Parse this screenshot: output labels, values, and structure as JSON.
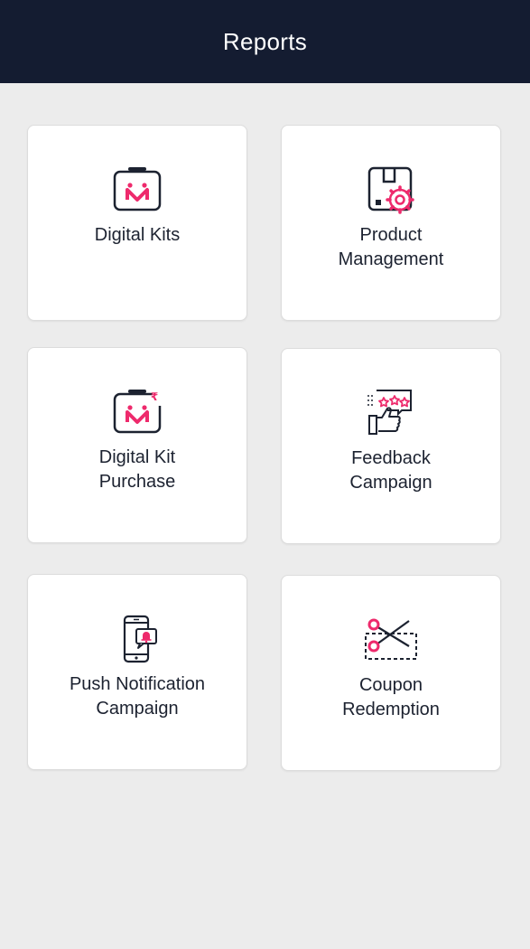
{
  "header": {
    "title": "Reports"
  },
  "colors": {
    "header_bg": "#141c31",
    "page_bg": "#ececec",
    "card_bg": "#ffffff",
    "icon_dark": "#1c2230",
    "icon_accent": "#ee2a6c"
  },
  "cards": [
    {
      "label": "Digital Kits",
      "icon": "digital-kit-icon"
    },
    {
      "label": "Product\nManagement",
      "icon": "product-management-icon"
    },
    {
      "label": "Digital Kit\nPurchase",
      "icon": "digital-kit-purchase-icon"
    },
    {
      "label": "Feedback\nCampaign",
      "icon": "feedback-campaign-icon"
    },
    {
      "label": "Push Notification\nCampaign",
      "icon": "push-notification-icon"
    },
    {
      "label": "Coupon\nRedemption",
      "icon": "coupon-scissors-icon"
    }
  ]
}
